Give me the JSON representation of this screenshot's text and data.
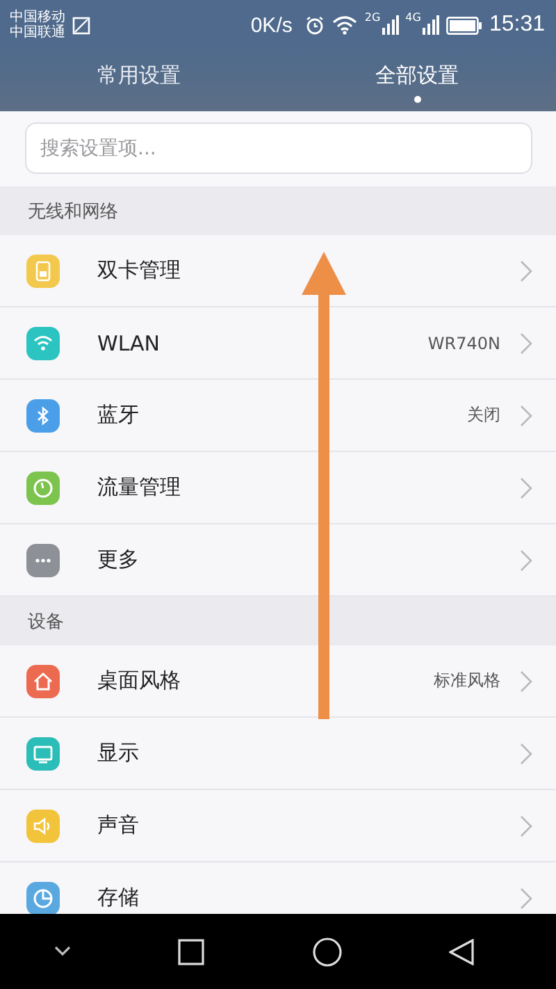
{
  "status_bar": {
    "carriers": [
      "中国移动",
      "中国联通"
    ],
    "speed": "0K/s",
    "networks": [
      "2G",
      "4G"
    ],
    "time": "15:31"
  },
  "tabs": [
    {
      "label": "常用设置",
      "selected": false
    },
    {
      "label": "全部设置",
      "selected": true
    }
  ],
  "search": {
    "placeholder": "搜索设置项..."
  },
  "sections": [
    {
      "title": "无线和网络",
      "items": [
        {
          "label": "双卡管理",
          "color": "#f2c94c"
        },
        {
          "label": "WLAN",
          "value": "WR740N",
          "color": "#2bc4c0"
        },
        {
          "label": "蓝牙",
          "value": "关闭",
          "color": "#4a9fe8"
        },
        {
          "label": "流量管理",
          "color": "#7cc44e"
        },
        {
          "label": "更多",
          "color": "#8e9097"
        }
      ]
    },
    {
      "title": "设备",
      "items": [
        {
          "label": "桌面风格",
          "value": "标准风格",
          "color": "#ec6a50"
        },
        {
          "label": "显示",
          "color": "#2bbdb7"
        },
        {
          "label": "声音",
          "color": "#f2c43c"
        },
        {
          "label": "存储",
          "color": "#5aa8e0"
        }
      ]
    }
  ],
  "annotation": {
    "kind": "up-arrow"
  }
}
